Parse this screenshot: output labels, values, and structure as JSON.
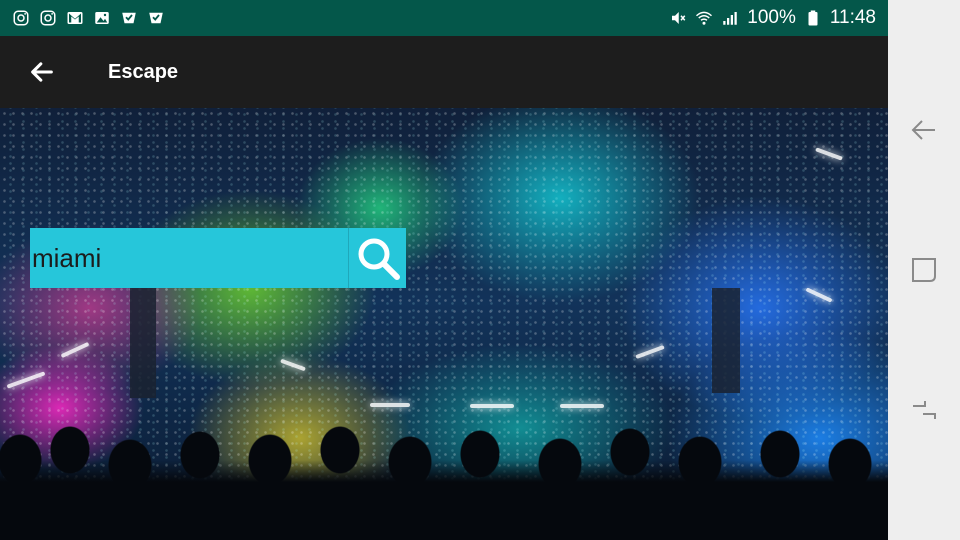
{
  "status_bar": {
    "battery": "100%",
    "time": "11:48",
    "left_icons": [
      "instagram-icon",
      "instagram-icon",
      "gmail-icon",
      "gallery-icon",
      "shop-icon",
      "shop-icon"
    ],
    "right_icons": [
      "mute-icon",
      "wifi-icon",
      "signal-icon",
      "battery-icon"
    ],
    "background": "#04574a"
  },
  "app_bar": {
    "title": "Escape",
    "back_icon": "arrow-left-icon",
    "background": "#1d1d1d"
  },
  "search": {
    "value": "miami",
    "button_icon": "search-icon",
    "accent": "#26c6da"
  },
  "nav_bar": {
    "items": [
      "back-icon",
      "recents-icon",
      "home-icon"
    ],
    "background": "#eeeeee"
  }
}
